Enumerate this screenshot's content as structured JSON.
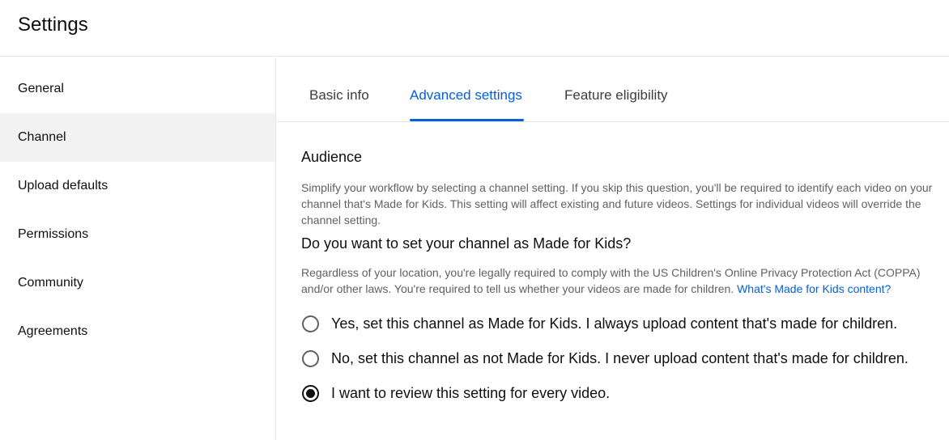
{
  "header": {
    "title": "Settings"
  },
  "sidebar": {
    "items": [
      {
        "label": "General"
      },
      {
        "label": "Channel"
      },
      {
        "label": "Upload defaults"
      },
      {
        "label": "Permissions"
      },
      {
        "label": "Community"
      },
      {
        "label": "Agreements"
      }
    ],
    "active": "Channel"
  },
  "tabs": [
    {
      "label": "Basic info"
    },
    {
      "label": "Advanced settings"
    },
    {
      "label": "Feature eligibility"
    }
  ],
  "active_tab": "Advanced settings",
  "audience": {
    "title": "Audience",
    "description": "Simplify your workflow by selecting a channel setting. If you skip this question, you'll be required to identify each video on your channel that's Made for Kids. This setting will affect existing and future videos. Settings for individual videos will override the channel setting.",
    "question": "Do you want to set your channel as Made for Kids?",
    "legal_text": "Regardless of your location, you're legally required to comply with the US Children's Online Privacy Protection Act (COPPA) and/or other laws. You're required to tell us whether your videos are made for children. ",
    "link_text": "What's Made for Kids content?",
    "options": [
      {
        "label": "Yes, set this channel as Made for Kids. I always upload content that's made for children.",
        "selected": false
      },
      {
        "label": "No, set this channel as not Made for Kids. I never upload content that's made for children.",
        "selected": false
      },
      {
        "label": "I want to review this setting for every video.",
        "selected": true
      }
    ]
  },
  "colors": {
    "accent": "#065fd4",
    "active_nav_bg": "#f2f2f2",
    "secondary_text": "#606060"
  }
}
